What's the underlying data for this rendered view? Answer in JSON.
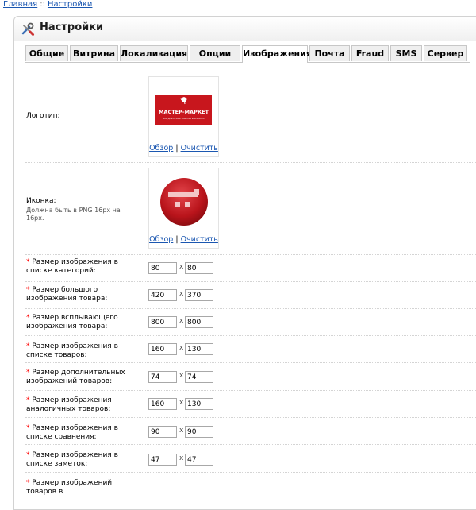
{
  "breadcrumb": {
    "home": "Главная",
    "separator": "::",
    "current": "Настройки"
  },
  "heading": {
    "title": "Настройки"
  },
  "tabs": [
    "Общие",
    "Витрина",
    "Локализация",
    "Опции",
    "Изображения",
    "Почта",
    "Fraud",
    "SMS",
    "Сервер"
  ],
  "active_tab": "Изображения",
  "logo": {
    "label": "Логотип:",
    "img_title": "МАСТЕР-МАРКЕТ",
    "img_subtitle": "ВСЕ ДЛЯ СТРОИТЕЛЬСТВА И РЕМОНТА",
    "browse": "Обзор",
    "sep": "|",
    "clear": "Очистить",
    "brand_color": "#c8161d"
  },
  "icon": {
    "label": "Иконка:",
    "help": "Должна быть в PNG 16px на 16px.",
    "browse": "Обзор",
    "sep": "|",
    "clear": "Очистить"
  },
  "required_mark": "*",
  "times": "x",
  "sizes": [
    {
      "label": "Размер изображения в списке категорий:",
      "w": "80",
      "h": "80"
    },
    {
      "label": "Размер большого изображения товара:",
      "w": "420",
      "h": "370"
    },
    {
      "label": "Размер всплывающего изображения товара:",
      "w": "800",
      "h": "800"
    },
    {
      "label": "Размер изображения в списке товаров:",
      "w": "160",
      "h": "130"
    },
    {
      "label": "Размер дополнительных изображений товаров:",
      "w": "74",
      "h": "74"
    },
    {
      "label": "Размер изображения аналогичных товаров:",
      "w": "160",
      "h": "130"
    },
    {
      "label": "Размер изображения в списке сравнения:",
      "w": "90",
      "h": "90"
    },
    {
      "label": "Размер изображения в списке заметок:",
      "w": "47",
      "h": "47"
    },
    {
      "label": "Размер изображений товаров в",
      "w": "",
      "h": ""
    }
  ]
}
